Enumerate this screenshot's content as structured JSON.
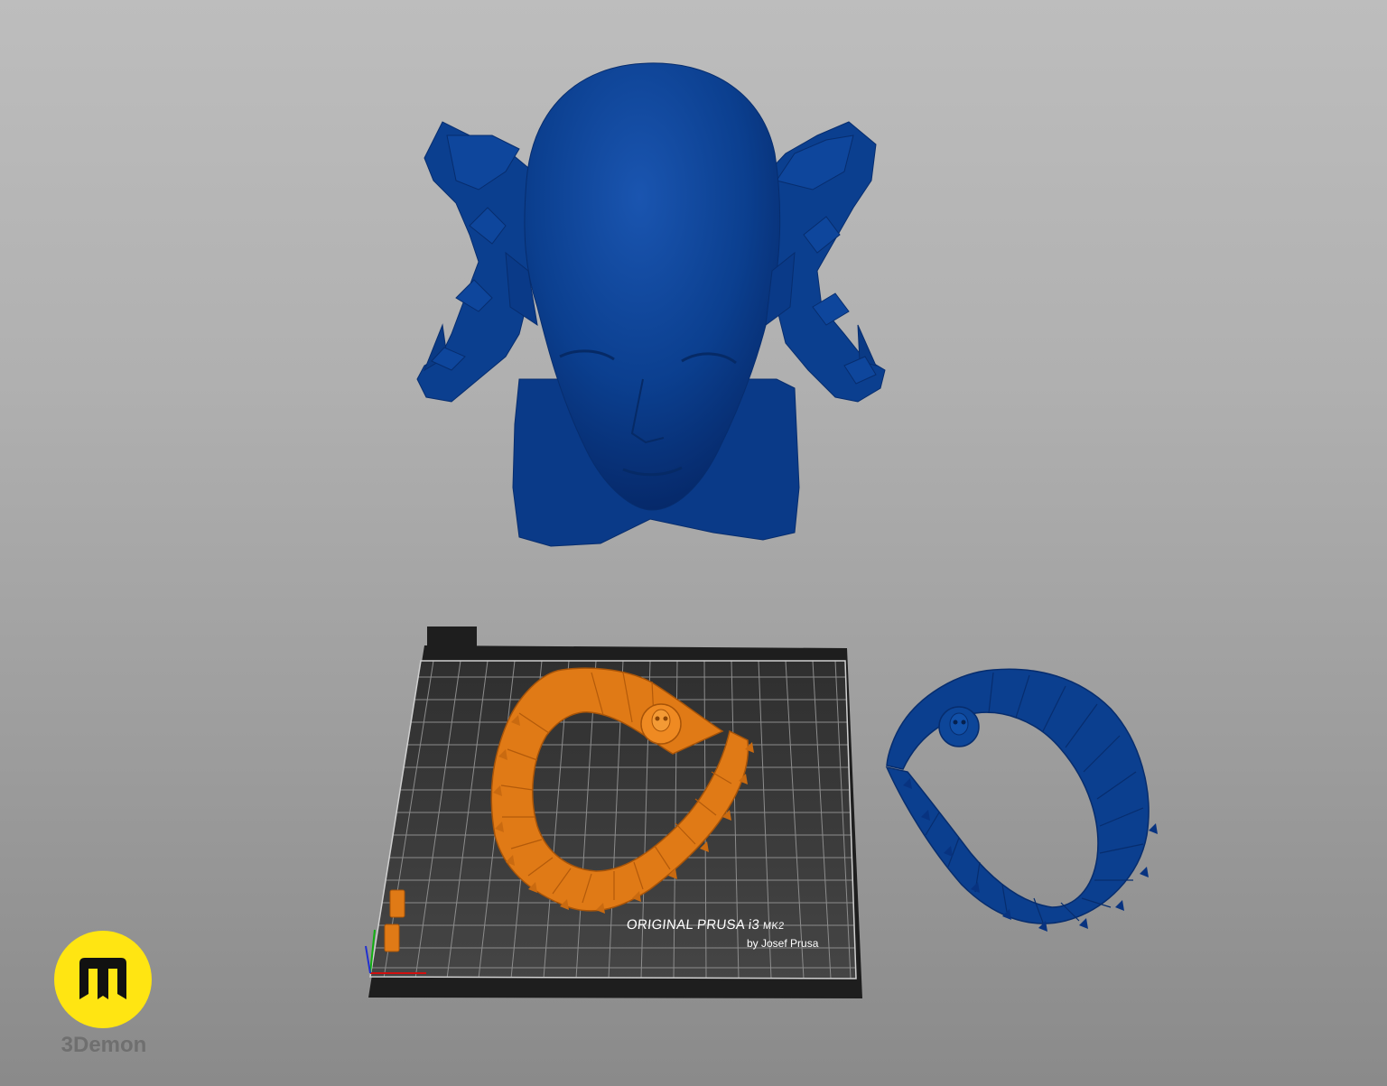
{
  "viewport": {
    "background_top": "#bdbdbd",
    "background_bottom": "#8a8a8a"
  },
  "models": {
    "head": {
      "name": "head-bust-model",
      "color": "#0b3f8f"
    },
    "horn_on_bed": {
      "name": "horn-model-on-bed",
      "color": "#e07a16"
    },
    "horn_side": {
      "name": "horn-model-side",
      "color": "#0b3f8f"
    }
  },
  "print_bed": {
    "title": "ORIGINAL PRUSA i3",
    "model_suffix": "MK2",
    "subtitle": "by Josef Prusa",
    "surface_color": "#3a3a3a",
    "frame_color": "#1e1e1e"
  },
  "brand": {
    "logo_icon": "3demon-m-logo-icon",
    "logo_color": "#ffe512",
    "name": "3Demon"
  }
}
